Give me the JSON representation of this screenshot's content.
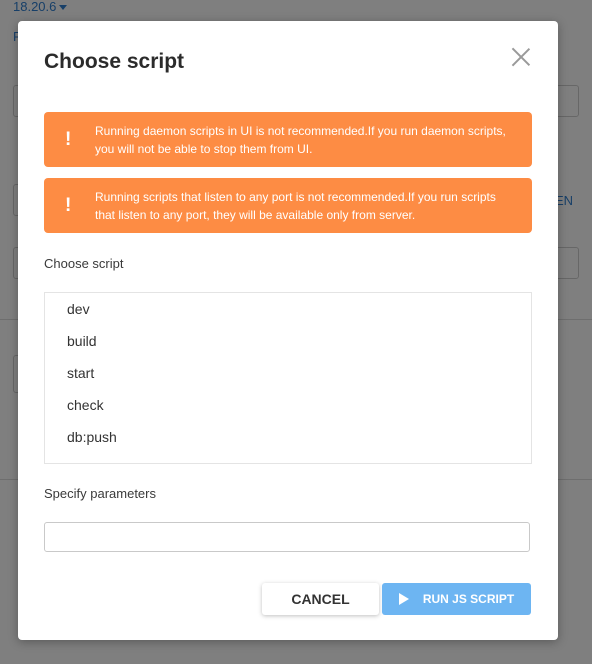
{
  "background": {
    "version": "18.20.6",
    "left_fragment": "F",
    "right_fragment": "EN"
  },
  "modal": {
    "title": "Choose script",
    "alerts": [
      {
        "text": "Running daemon scripts in UI is not recommended.If you run daemon scripts, you will not be able to stop them from UI."
      },
      {
        "text": "Running scripts that listen to any port is not recommended.If you run scripts that listen to any port, they will be available only from server."
      }
    ],
    "choose_label": "Choose script",
    "scripts": [
      "dev",
      "build",
      "start",
      "check",
      "db:push"
    ],
    "params_label": "Specify parameters",
    "params_value": "",
    "cancel_label": "CANCEL",
    "run_label": "RUN JS SCRIPT"
  },
  "colors": {
    "alert": "#fd8c44",
    "primary_disabled": "#6db5f2",
    "link": "#2f7fd1"
  }
}
